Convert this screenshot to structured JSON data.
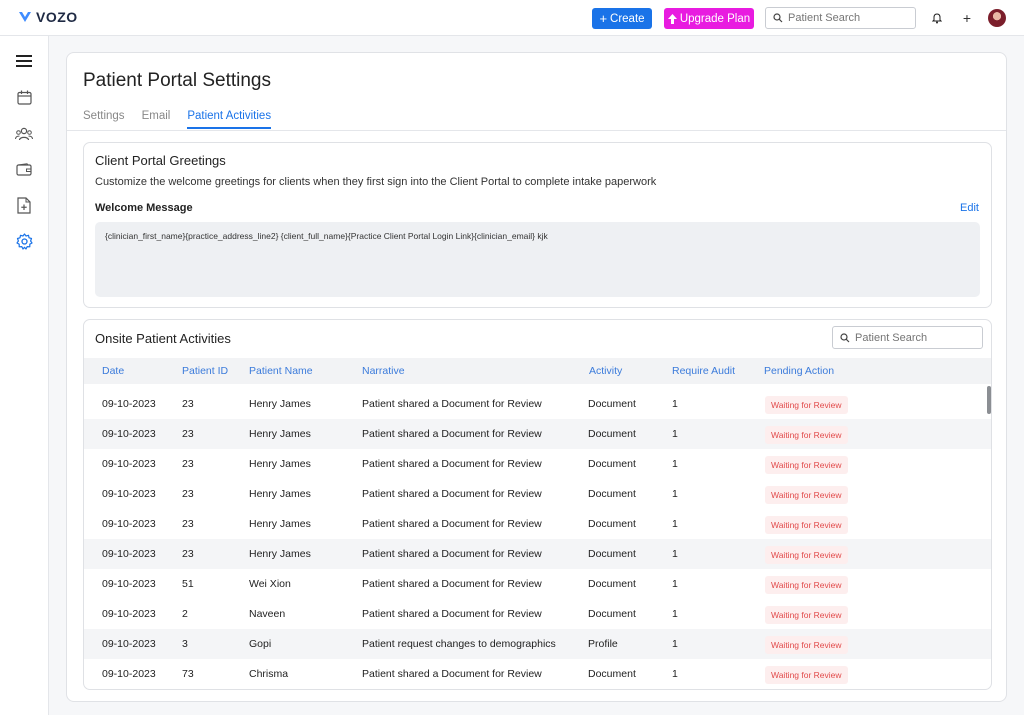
{
  "topbar": {
    "brand": "VOZO",
    "create_label": "Create",
    "upgrade_label": "Upgrade Plan",
    "search_placeholder": "Patient Search",
    "brand_color": "#1a73e8",
    "upgrade_color": "#e81be0"
  },
  "sidebar": {
    "icons": [
      "menu-icon",
      "calendar-icon",
      "users-icon",
      "wallet-icon",
      "document-add-icon",
      "settings-icon"
    ],
    "active": "settings-icon"
  },
  "page": {
    "title": "Patient Portal Settings",
    "tabs": [
      {
        "label": "Settings",
        "active": false
      },
      {
        "label": "Email",
        "active": false
      },
      {
        "label": "Patient Activities",
        "active": true
      }
    ]
  },
  "greetings": {
    "title": "Client Portal Greetings",
    "description": "Customize the welcome greetings for clients when they first sign into the Client Portal to complete intake paperwork",
    "welcome_label": "Welcome Message",
    "edit_label": "Edit",
    "message": "{clinician_first_name}{practice_address_line2} {client_full_name}{Practice Client Portal Login Link}{clinician_email} kjk"
  },
  "activities": {
    "title": "Onsite Patient Activities",
    "search_placeholder": "Patient Search",
    "columns": [
      "Date",
      "Patient ID",
      "Patient Name",
      "Narrative",
      "Activity",
      "Require Audit",
      "Pending Action"
    ],
    "rows": [
      {
        "date": "09-10-2023",
        "id": "23",
        "name": "Henry James",
        "narrative": "Patient shared a Document for Review",
        "activity": "Document",
        "audit": "1",
        "action": "Waiting for Review"
      },
      {
        "date": "09-10-2023",
        "id": "23",
        "name": "Henry James",
        "narrative": "Patient shared a Document for Review",
        "activity": "Document",
        "audit": "1",
        "action": "Waiting for Review"
      },
      {
        "date": "09-10-2023",
        "id": "23",
        "name": "Henry James",
        "narrative": "Patient shared a Document for Review",
        "activity": "Document",
        "audit": "1",
        "action": "Waiting for Review"
      },
      {
        "date": "09-10-2023",
        "id": "23",
        "name": "Henry James",
        "narrative": "Patient shared a Document for Review",
        "activity": "Document",
        "audit": "1",
        "action": "Waiting for Review"
      },
      {
        "date": "09-10-2023",
        "id": "23",
        "name": "Henry James",
        "narrative": "Patient shared a Document for Review",
        "activity": "Document",
        "audit": "1",
        "action": "Waiting for Review"
      },
      {
        "date": "09-10-2023",
        "id": "23",
        "name": "Henry James",
        "narrative": "Patient shared a Document for Review",
        "activity": "Document",
        "audit": "1",
        "action": "Waiting for Review"
      },
      {
        "date": "09-10-2023",
        "id": "51",
        "name": "Wei Xion",
        "narrative": "Patient shared a Document for Review",
        "activity": "Document",
        "audit": "1",
        "action": "Waiting for Review"
      },
      {
        "date": "09-10-2023",
        "id": "2",
        "name": "Naveen",
        "narrative": "Patient shared a Document for Review",
        "activity": "Document",
        "audit": "1",
        "action": "Waiting for Review"
      },
      {
        "date": "09-10-2023",
        "id": "3",
        "name": "Gopi",
        "narrative": "Patient request changes to demographics",
        "activity": "Profile",
        "audit": "1",
        "action": "Waiting for Review"
      },
      {
        "date": "09-10-2023",
        "id": "73",
        "name": "Chrisma",
        "narrative": "Patient shared a Document for Review",
        "activity": "Document",
        "audit": "1",
        "action": "Waiting for Review"
      }
    ]
  }
}
